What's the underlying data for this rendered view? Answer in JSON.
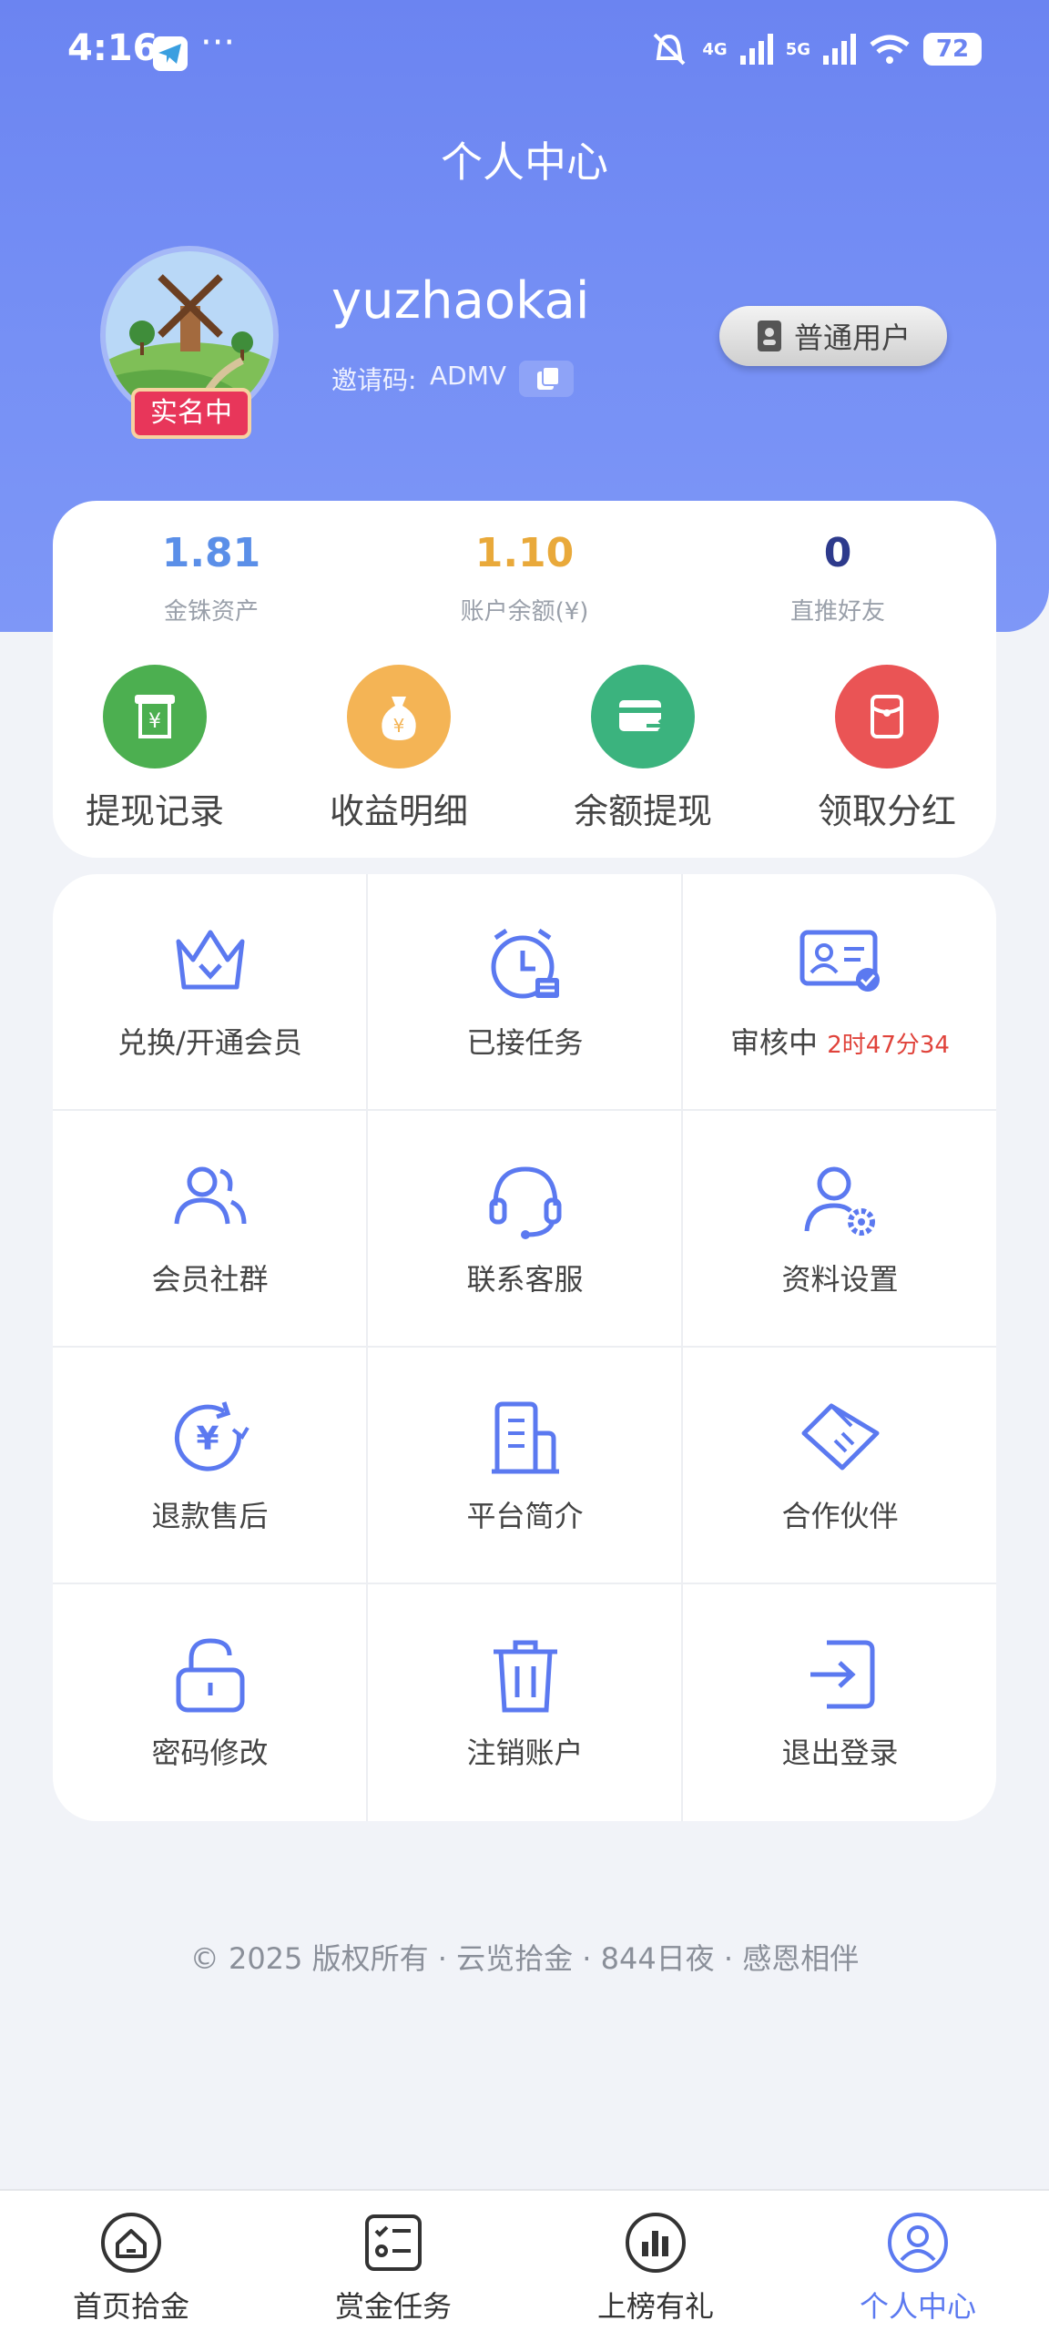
{
  "status": {
    "time": "4:16",
    "dots": "···",
    "battery": "72",
    "net1": "4G",
    "net2": "5G"
  },
  "page_title": "个人中心",
  "profile": {
    "username": "yuzhaokai",
    "invite_label": "邀请码:",
    "invite_code": "ADMV",
    "realname_badge": "实名中",
    "user_level": "普通用户"
  },
  "stats": [
    {
      "value": "1.81",
      "label": "金铢资产",
      "color": "#5b8fe8"
    },
    {
      "value": "1.10",
      "label": "账户余额(¥)",
      "color": "#e9a93a"
    },
    {
      "value": "0",
      "label": "直推好友",
      "color": "#2d3a8c"
    }
  ],
  "quick_actions": [
    {
      "label": "提现记录",
      "icon": "atm-yuan-icon",
      "color": "#4caf50"
    },
    {
      "label": "收益明细",
      "icon": "money-bag-icon",
      "color": "#f4b455"
    },
    {
      "label": "余额提现",
      "icon": "card-transfer-icon",
      "color": "#3bb37e"
    },
    {
      "label": "领取分红",
      "icon": "red-envelope-icon",
      "color": "#ea5455"
    }
  ],
  "menu": [
    {
      "label": "兑换/开通会员",
      "icon": "crown-icon"
    },
    {
      "label": "已接任务",
      "icon": "alarm-clock-icon"
    },
    {
      "label": "审核中",
      "icon": "id-card-check-icon",
      "countdown": "2时47分34"
    },
    {
      "label": "会员社群",
      "icon": "users-icon"
    },
    {
      "label": "联系客服",
      "icon": "headset-icon"
    },
    {
      "label": "资料设置",
      "icon": "user-gear-icon"
    },
    {
      "label": "退款售后",
      "icon": "yuan-refund-icon"
    },
    {
      "label": "平台简介",
      "icon": "building-icon"
    },
    {
      "label": "合作伙伴",
      "icon": "handshake-icon"
    },
    {
      "label": "密码修改",
      "icon": "unlock-icon"
    },
    {
      "label": "注销账户",
      "icon": "trash-icon"
    },
    {
      "label": "退出登录",
      "icon": "logout-icon"
    }
  ],
  "copyright": "© 2025 版权所有 · 云览拾金 · 844日夜 · 感恩相伴",
  "tabs": [
    {
      "label": "首页拾金",
      "icon": "home-icon"
    },
    {
      "label": "赏金任务",
      "icon": "checklist-icon"
    },
    {
      "label": "上榜有礼",
      "icon": "bar-chart-icon"
    },
    {
      "label": "个人中心",
      "icon": "user-circle-icon",
      "active": true
    }
  ]
}
